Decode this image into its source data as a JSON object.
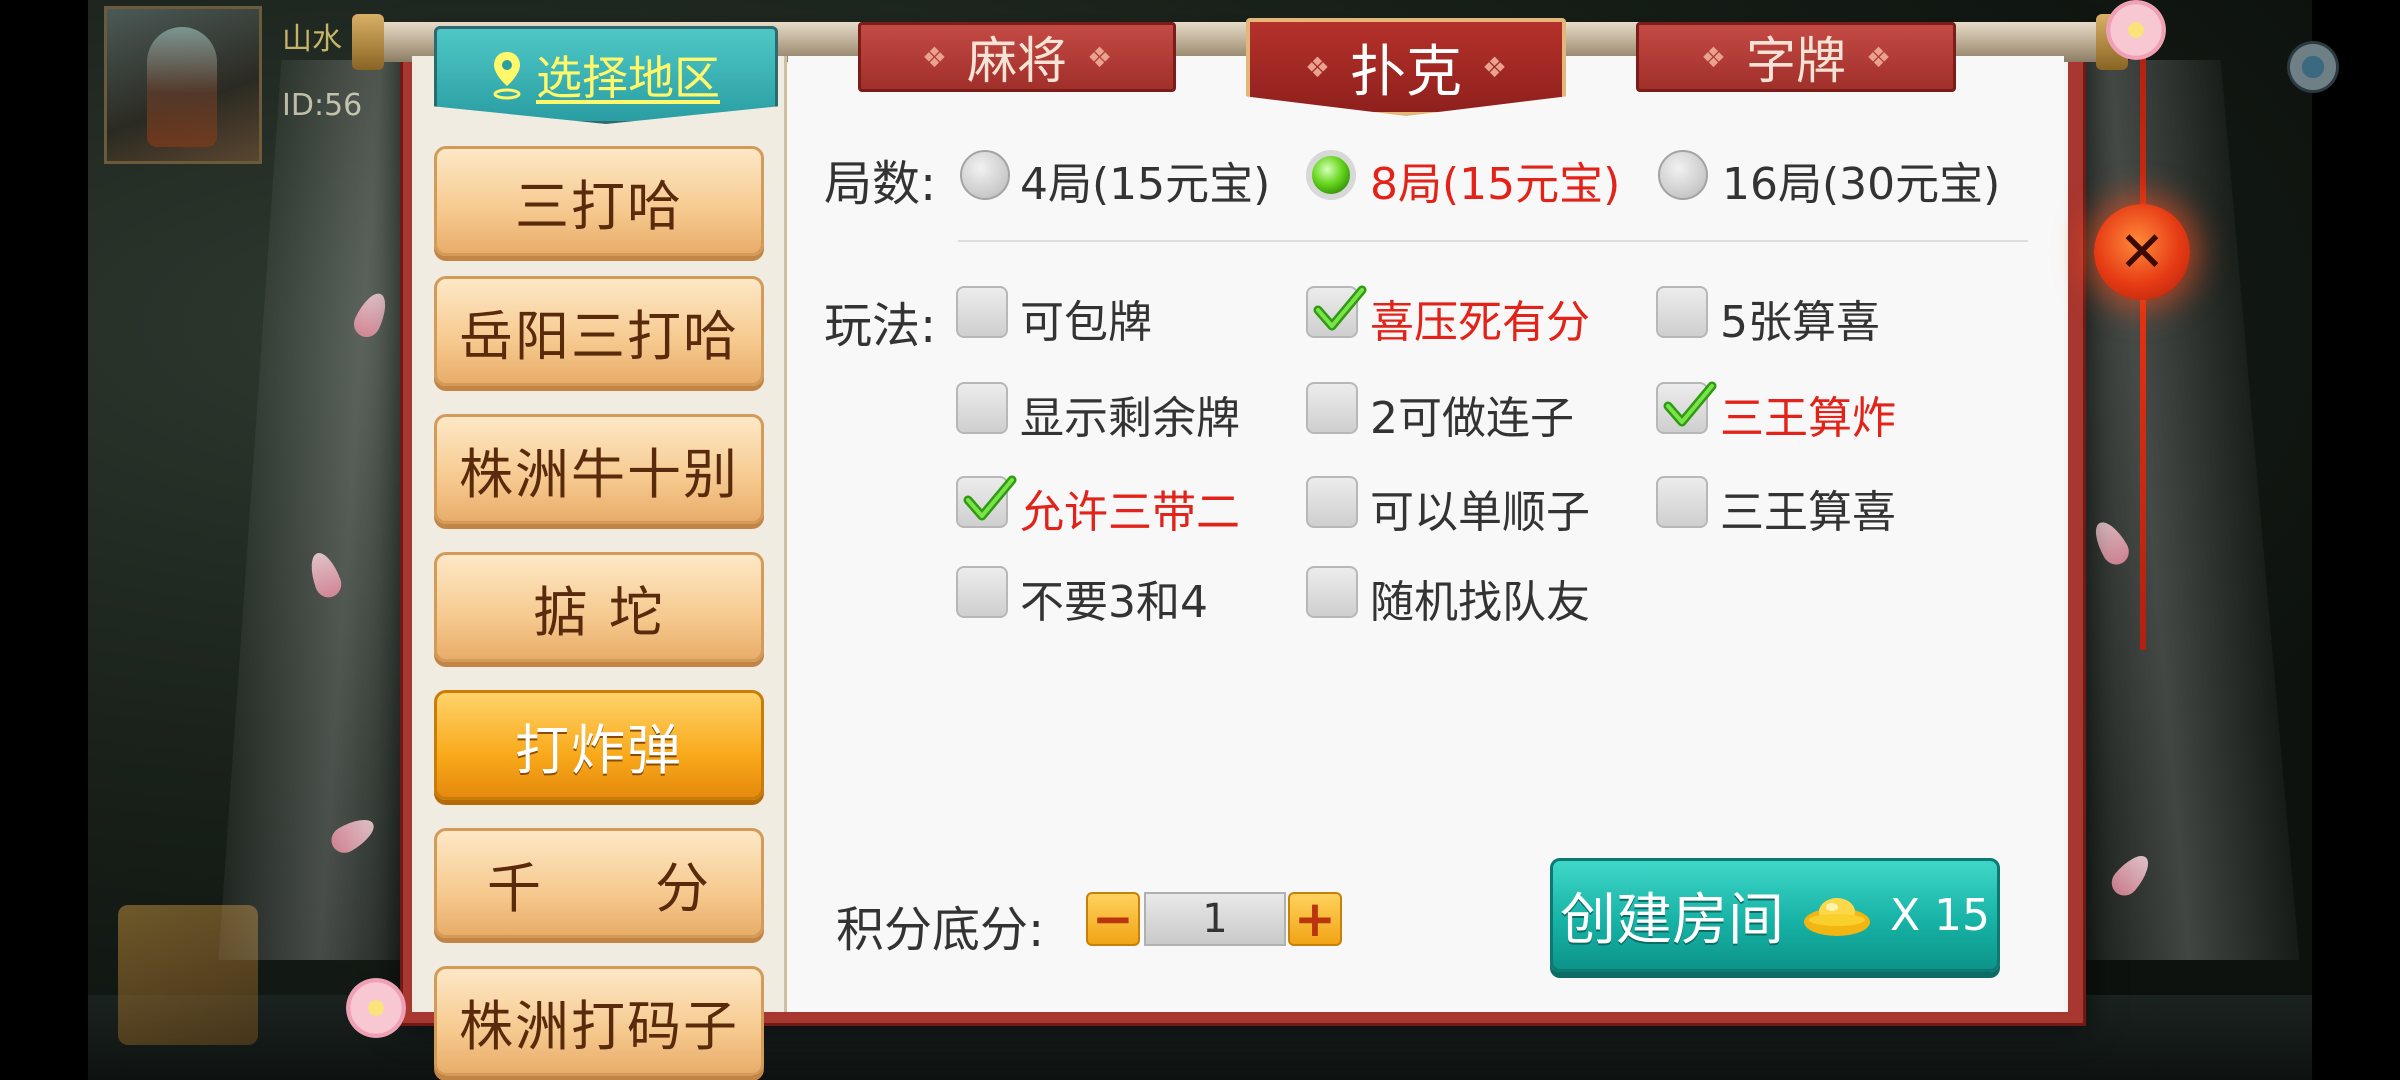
{
  "background": {
    "player_name": "山水",
    "player_id": "ID:56"
  },
  "region": {
    "label": "选择地区"
  },
  "tabs": [
    {
      "label": "麻将",
      "active": false
    },
    {
      "label": "扑克",
      "active": true
    },
    {
      "label": "字牌",
      "active": false
    }
  ],
  "sidebar": {
    "items": [
      {
        "label": "三打哈",
        "active": false
      },
      {
        "label": "岳阳三打哈",
        "active": false
      },
      {
        "label": "株洲牛十别",
        "active": false
      },
      {
        "label": "掂 坨",
        "active": false
      },
      {
        "label": "打炸弹",
        "active": true
      },
      {
        "label": "千　　分",
        "active": false
      },
      {
        "label": "株洲打码子",
        "active": false
      }
    ]
  },
  "rounds": {
    "label": "局数:",
    "options": [
      {
        "text": "4局(15元宝)",
        "selected": false
      },
      {
        "text": "8局(15元宝)",
        "selected": true
      },
      {
        "text": "16局(30元宝)",
        "selected": false
      }
    ]
  },
  "rules": {
    "label": "玩法:",
    "options": [
      {
        "text": "可包牌",
        "checked": false
      },
      {
        "text": "喜压死有分",
        "checked": true
      },
      {
        "text": "5张算喜",
        "checked": false
      },
      {
        "text": "显示剩余牌",
        "checked": false
      },
      {
        "text": "2可做连子",
        "checked": false
      },
      {
        "text": "三王算炸",
        "checked": true
      },
      {
        "text": "允许三带二",
        "checked": true
      },
      {
        "text": "可以单顺子",
        "checked": false
      },
      {
        "text": "三王算喜",
        "checked": false
      },
      {
        "text": "不要3和4",
        "checked": false
      },
      {
        "text": "随机找队友",
        "checked": false
      }
    ]
  },
  "score": {
    "label": "积分底分:",
    "minus": "−",
    "value": "1",
    "plus": "+"
  },
  "create": {
    "label": "创建房间",
    "multiplier": "X 15"
  },
  "close": {
    "symbol": "✕"
  },
  "colors": {
    "checked_text": "#e2231a",
    "accent_teal": "#17b3a6",
    "tab_red": "#a12f2a"
  }
}
